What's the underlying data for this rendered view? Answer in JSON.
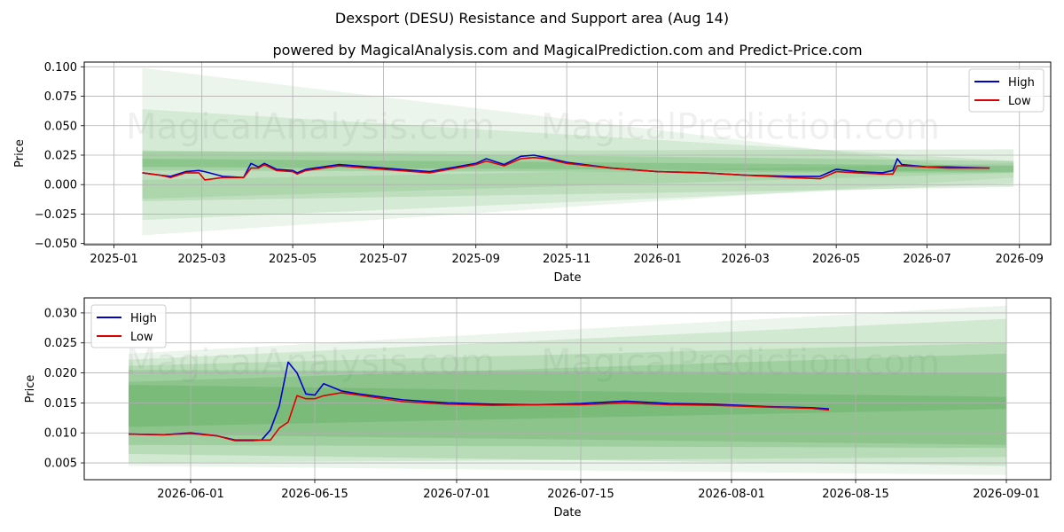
{
  "title": "Dexsport (DESU) Resistance and Support area (Aug 14)",
  "subtitle": "powered by MagicalAnalysis.com and MagicalPrediction.com and Predict-Price.com",
  "watermark": [
    "MagicalAnalysis.com",
    "MagicalPrediction.com"
  ],
  "colors": {
    "high": "#0000cc",
    "low": "#dd0000",
    "band": "#3a9a3a",
    "grid": "#b0b0b0"
  },
  "chart_data": [
    {
      "type": "line",
      "xlabel": "Date",
      "ylabel": "Price",
      "grid": true,
      "legend": "top-right",
      "x_ticks": [
        "2025-01",
        "2025-03",
        "2025-05",
        "2025-07",
        "2025-09",
        "2025-11",
        "2026-01",
        "2026-03",
        "2026-05",
        "2026-07",
        "2026-09"
      ],
      "y_ticks": [
        "−0.050",
        "−0.025",
        "0.000",
        "0.025",
        "0.050",
        "0.075",
        "0.100"
      ],
      "xlim": [
        "2024-12-12",
        "2026-09-22"
      ],
      "ylim": [
        -0.051,
        0.104
      ],
      "series": [
        {
          "name": "High",
          "x": [
            "2025-01-20",
            "2025-02-01",
            "2025-02-08",
            "2025-02-18",
            "2025-02-27",
            "2025-03-03",
            "2025-03-15",
            "2025-03-29",
            "2025-04-03",
            "2025-04-08",
            "2025-04-12",
            "2025-04-20",
            "2025-05-01",
            "2025-05-04",
            "2025-05-10",
            "2025-06-01",
            "2025-07-01",
            "2025-08-01",
            "2025-09-01",
            "2025-09-08",
            "2025-09-20",
            "2025-10-01",
            "2025-10-10",
            "2025-10-18",
            "2025-11-01",
            "2025-12-01",
            "2026-01-01",
            "2026-02-01",
            "2026-03-01",
            "2026-04-01",
            "2026-04-20",
            "2026-05-01",
            "2026-05-15",
            "2026-06-01",
            "2026-06-08",
            "2026-06-11",
            "2026-06-14",
            "2026-07-01",
            "2026-07-15",
            "2026-08-12"
          ],
          "values": [
            0.01,
            0.008,
            0.007,
            0.011,
            0.012,
            0.011,
            0.007,
            0.006,
            0.018,
            0.015,
            0.018,
            0.013,
            0.012,
            0.01,
            0.013,
            0.017,
            0.014,
            0.011,
            0.018,
            0.022,
            0.017,
            0.024,
            0.025,
            0.023,
            0.019,
            0.014,
            0.011,
            0.01,
            0.008,
            0.007,
            0.007,
            0.013,
            0.011,
            0.01,
            0.012,
            0.022,
            0.017,
            0.015,
            0.015,
            0.014
          ]
        },
        {
          "name": "Low",
          "x": [
            "2025-01-20",
            "2025-02-01",
            "2025-02-08",
            "2025-02-18",
            "2025-02-27",
            "2025-03-03",
            "2025-03-15",
            "2025-03-29",
            "2025-04-03",
            "2025-04-08",
            "2025-04-12",
            "2025-04-20",
            "2025-05-01",
            "2025-05-04",
            "2025-05-10",
            "2025-06-01",
            "2025-07-01",
            "2025-08-01",
            "2025-09-01",
            "2025-09-08",
            "2025-09-20",
            "2025-10-01",
            "2025-10-10",
            "2025-10-18",
            "2025-11-01",
            "2025-12-01",
            "2026-01-01",
            "2026-02-01",
            "2026-03-01",
            "2026-04-01",
            "2026-04-20",
            "2026-05-01",
            "2026-05-15",
            "2026-06-01",
            "2026-06-08",
            "2026-06-11",
            "2026-06-14",
            "2026-07-01",
            "2026-07-15",
            "2026-08-12"
          ],
          "values": [
            0.01,
            0.008,
            0.006,
            0.01,
            0.01,
            0.004,
            0.006,
            0.006,
            0.014,
            0.014,
            0.017,
            0.012,
            0.011,
            0.009,
            0.012,
            0.016,
            0.013,
            0.01,
            0.017,
            0.02,
            0.016,
            0.022,
            0.023,
            0.022,
            0.018,
            0.014,
            0.011,
            0.01,
            0.008,
            0.006,
            0.005,
            0.011,
            0.01,
            0.009,
            0.009,
            0.016,
            0.016,
            0.015,
            0.014,
            0.014
          ]
        }
      ]
    },
    {
      "type": "line",
      "xlabel": "Date",
      "ylabel": "Price",
      "grid": true,
      "legend": "top-left",
      "x_ticks": [
        "2026-06-01",
        "2026-06-15",
        "2026-07-01",
        "2026-07-15",
        "2026-08-01",
        "2026-08-15",
        "2026-09-01"
      ],
      "y_ticks": [
        "0.005",
        "0.010",
        "0.015",
        "0.020",
        "0.025",
        "0.030"
      ],
      "xlim": [
        "2026-05-20",
        "2026-09-06"
      ],
      "ylim": [
        0.0022,
        0.0325
      ],
      "series": [
        {
          "name": "High",
          "x": [
            "2026-05-25",
            "2026-05-29",
            "2026-06-01",
            "2026-06-04",
            "2026-06-06",
            "2026-06-08",
            "2026-06-09",
            "2026-06-10",
            "2026-06-11",
            "2026-06-12",
            "2026-06-13",
            "2026-06-14",
            "2026-06-15",
            "2026-06-16",
            "2026-06-18",
            "2026-06-20",
            "2026-06-25",
            "2026-06-30",
            "2026-07-05",
            "2026-07-10",
            "2026-07-15",
            "2026-07-20",
            "2026-07-25",
            "2026-07-30",
            "2026-08-05",
            "2026-08-10",
            "2026-08-12"
          ],
          "values": [
            0.0098,
            0.0097,
            0.01,
            0.0095,
            0.0088,
            0.0088,
            0.0088,
            0.0105,
            0.0145,
            0.0218,
            0.02,
            0.0165,
            0.0163,
            0.0182,
            0.017,
            0.0165,
            0.0155,
            0.015,
            0.0148,
            0.0147,
            0.0149,
            0.0153,
            0.0149,
            0.0148,
            0.0144,
            0.0142,
            0.014
          ]
        },
        {
          "name": "Low",
          "x": [
            "2026-05-25",
            "2026-05-29",
            "2026-06-01",
            "2026-06-04",
            "2026-06-06",
            "2026-06-08",
            "2026-06-09",
            "2026-06-10",
            "2026-06-11",
            "2026-06-12",
            "2026-06-13",
            "2026-06-14",
            "2026-06-15",
            "2026-06-16",
            "2026-06-18",
            "2026-06-20",
            "2026-06-25",
            "2026-06-30",
            "2026-07-05",
            "2026-07-10",
            "2026-07-15",
            "2026-07-20",
            "2026-07-25",
            "2026-07-30",
            "2026-08-05",
            "2026-08-10",
            "2026-08-12"
          ],
          "values": [
            0.0098,
            0.0097,
            0.0099,
            0.0095,
            0.0087,
            0.0087,
            0.0088,
            0.0088,
            0.0108,
            0.0118,
            0.0162,
            0.0157,
            0.0157,
            0.0162,
            0.0167,
            0.0163,
            0.0152,
            0.0148,
            0.0146,
            0.0147,
            0.0147,
            0.015,
            0.0147,
            0.0146,
            0.0143,
            0.0141,
            0.0138
          ]
        }
      ]
    }
  ]
}
